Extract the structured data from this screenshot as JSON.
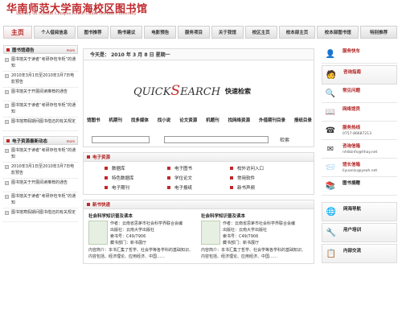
{
  "header": {
    "title": "华南师范大学南海校区图书馆",
    "subtitle": "Library Of Nanhai Campus,South China Normal University"
  },
  "nav": [
    {
      "label": "主页"
    },
    {
      "label": "个人借阅信息"
    },
    {
      "label": "图书推荐"
    },
    {
      "label": "购书建议"
    },
    {
      "label": "电影预告"
    },
    {
      "label": "服务项目"
    },
    {
      "label": "关于我馆"
    },
    {
      "label": "校区主页"
    },
    {
      "label": "校本部主页"
    },
    {
      "label": "校本部图书馆"
    },
    {
      "label": "特别推荐"
    }
  ],
  "left": {
    "panel1": {
      "title": "图书馆通告",
      "more": "more",
      "items": [
        "图书馆关于读者“考研存包专柜”的通知",
        "2010年3月1日至2010年3月7日电影预告",
        "图书馆关于开展阅读推荐的通告",
        "图书馆关于读者“考研存包专柜”的通知",
        "图书馆寒假期间图书借还的有关规定"
      ]
    },
    "panel2": {
      "title": "电子资源最新动态",
      "more": "more",
      "items": [
        "图书馆关于读者“考研存包专柜”的通知",
        "2010年3月1日至2010年3月7日电影预告",
        "图书馆关于开展阅读推荐的通告",
        "图书馆关于读者“考研存包专柜”的通知",
        "图书馆寒假期间图书借还的有关规定"
      ]
    }
  },
  "center": {
    "date": "今天是： 2010 年 3 月 8 日 星期一",
    "quicksearch": {
      "logo_pre": "QUICK",
      "logo_s": "S",
      "logo_post": "EARCH",
      "cn": "快速检索",
      "links": [
        "馆图书",
        "机期刊",
        "找多媒体",
        "找小说",
        "论文资源",
        "机题刊",
        "找网络资源",
        "外借期刊目录",
        "报纸目录"
      ],
      "select_value": "",
      "button": "检索"
    },
    "eres": {
      "title": "电子资源",
      "items": [
        "数据库",
        "电子图书",
        "校外访问入口",
        "特色数据库",
        "学位论文",
        "常用软件",
        "电子期刊",
        "电子报纸",
        "新书声频"
      ]
    },
    "newbooks": {
      "title": "新书快递",
      "books": [
        {
          "title": "社会科学知识普及读本",
          "author": "作者：云南省思茅市社会科学界联合会编",
          "publisher": "出版社：云南大学出版社",
          "callno": "索书号：C49/7906",
          "location": "藏书部门：新书展厅",
          "desc": "内容简介：本书汇集了哲学、社会学等各学科的基础知识、内容包括、经济理论、应用经济、中国……"
        },
        {
          "title": "社会科学知识普及读本",
          "author": "作者：云南省思茅市社会科学界联合会编",
          "publisher": "出版社：云南大学出版社",
          "callno": "索书号：C49/7906",
          "location": "藏书部门：新书展厅",
          "desc": "内容简介：本书汇集了哲学、社会学等各学科的基础知识、内容包括、经济理论、应用经济、中国……"
        }
      ]
    }
  },
  "right": {
    "items": [
      {
        "label": "服务快车",
        "info": "",
        "icon": "person-icon"
      },
      {
        "label": "咨询指南",
        "info": "",
        "icon": "guide-icon"
      },
      {
        "label": "常见问题",
        "info": "",
        "icon": "faq-icon"
      },
      {
        "label": "网络馆员",
        "info": "",
        "icon": "librarian-icon"
      },
      {
        "label": "服务热线",
        "info": "0757-86687213",
        "icon": "phone-icon"
      },
      {
        "label": "咨询信箱",
        "info": "nhlibinfo@hhay.net",
        "icon": "mail-icon"
      },
      {
        "label": "馆长信箱",
        "info": "liyuanzu@yeah.net",
        "icon": "letter-icon"
      },
      {
        "label": "图书捐赠",
        "info": "",
        "icon": "books-icon"
      },
      {
        "label": "网海导航",
        "info": "",
        "icon": "nav-icon"
      },
      {
        "label": "用户培训",
        "info": "",
        "icon": "training-icon"
      },
      {
        "label": "内部交流",
        "info": "",
        "icon": "exchange-icon"
      }
    ]
  },
  "colors": {
    "accent": "#c0282b",
    "nav_bg": "#e8e8e8"
  }
}
